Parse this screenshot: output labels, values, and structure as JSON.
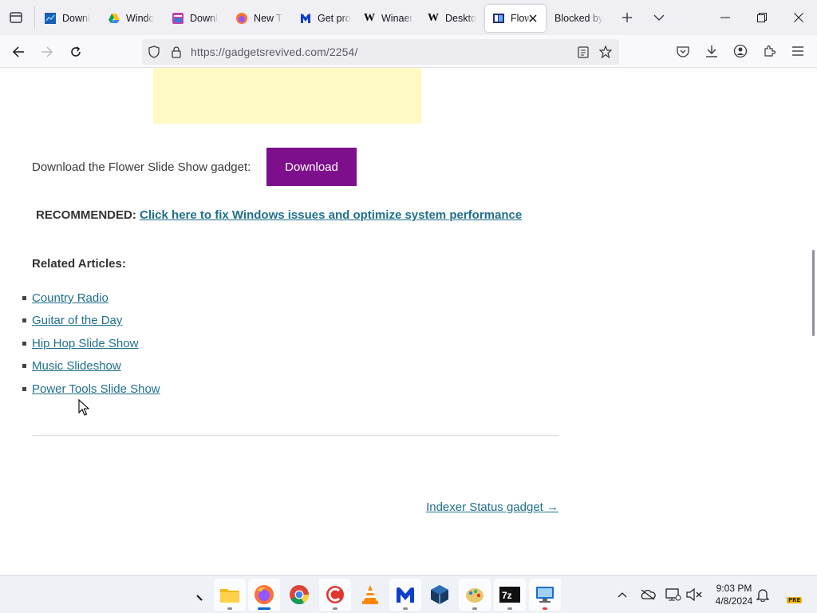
{
  "browser": {
    "tabs": [
      {
        "title": "Downl",
        "icon": "taskmanager-icon",
        "active": false
      },
      {
        "title": "Windo",
        "icon": "google-drive-icon",
        "active": false
      },
      {
        "title": "Downl",
        "icon": "app-window-icon",
        "active": false
      },
      {
        "title": "New T",
        "icon": "firefox-icon",
        "active": false
      },
      {
        "title": "Get pro",
        "icon": "malwarebytes-icon",
        "active": false
      },
      {
        "title": "Winaer",
        "icon": "winaero-icon",
        "active": false
      },
      {
        "title": "Deskto",
        "icon": "winaero-icon",
        "active": false
      },
      {
        "title": "Flow",
        "icon": "gadget-icon",
        "active": true
      },
      {
        "title": "Blocked by",
        "icon": "",
        "active": false
      }
    ],
    "url": "https://gadgetsrevived.com/2254/"
  },
  "page": {
    "download_label": "Download the Flower Slide Show gadget:",
    "download_button": "Download",
    "recommended_label": "RECOMMENDED:",
    "recommended_link": "Click here to fix Windows issues and optimize system performance",
    "related_heading": "Related Articles:",
    "related": [
      "Country Radio",
      "Guitar of the Day",
      "Hip Hop Slide Show",
      "Music Slideshow",
      "Power Tools Slide Show"
    ],
    "next_post": "Indexer Status gadget →"
  },
  "taskbar": {
    "apps": [
      "file-explorer",
      "firefox",
      "chrome",
      "ccleaner",
      "vlc",
      "malwarebytes",
      "virtualbox",
      "paint-tool",
      "7zip",
      "remote-desktop"
    ],
    "time": "9:03 PM",
    "date": "4/8/2024",
    "badge": "PRE"
  },
  "colors": {
    "accent_link": "#1f6f8b",
    "download_button": "#7d0f8c",
    "ad_box": "#fff9c4"
  }
}
